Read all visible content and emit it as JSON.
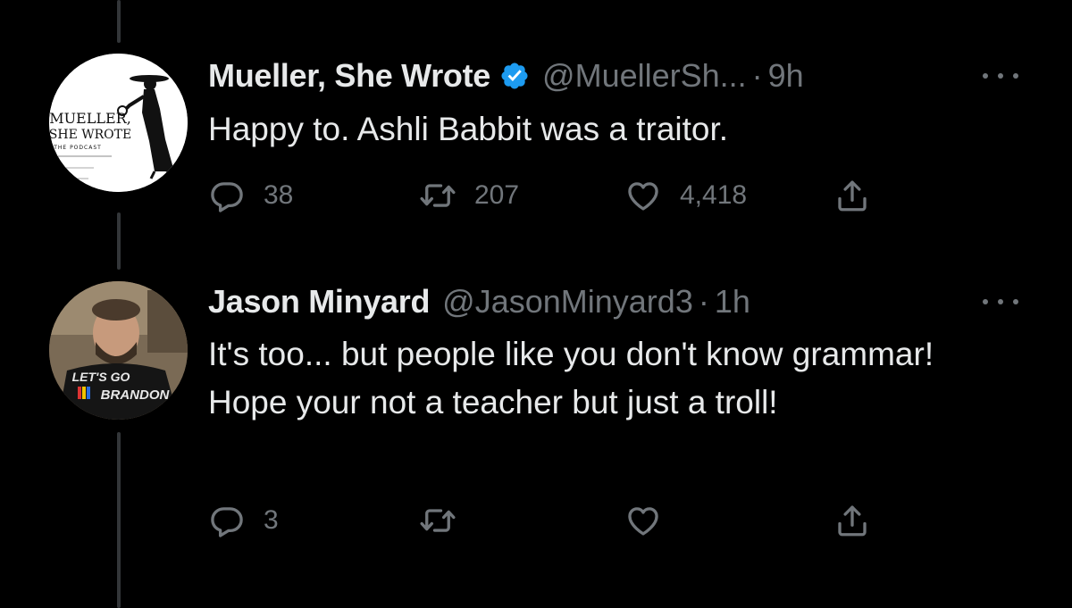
{
  "colors": {
    "background": "#000000",
    "text_primary": "#e7e9ea",
    "text_secondary": "#71767b",
    "verified_badge": "#1d9bf0",
    "thread_line": "#333639"
  },
  "tweets": [
    {
      "avatar": {
        "kind": "podcast-logo",
        "logo_line1": "MUELLER,",
        "logo_line2": "SHE WROTE",
        "logo_line3": "THE PODCAST"
      },
      "display_name": "Mueller, She Wrote",
      "verified": true,
      "handle": "@MuellerSh...",
      "separator": "·",
      "time": "9h",
      "text": "Happy to. Ashli Babbit was a traitor.",
      "actions": {
        "reply_icon": "reply-icon",
        "reply_count": "38",
        "retweet_icon": "retweet-icon",
        "retweet_count": "207",
        "like_icon": "like-icon",
        "like_count": "4,418",
        "share_icon": "share-icon"
      }
    },
    {
      "avatar": {
        "kind": "user-photo",
        "shirt_text_line1": "LET'S GO",
        "shirt_text_line2": "BRANDON"
      },
      "display_name": "Jason Minyard",
      "verified": false,
      "handle": "@JasonMinyard3",
      "separator": "·",
      "time": "1h",
      "text": "It's too... but people like you don't know grammar! Hope your not a teacher but just a troll!",
      "actions": {
        "reply_icon": "reply-icon",
        "reply_count": "3",
        "retweet_icon": "retweet-icon",
        "retweet_count": "",
        "like_icon": "like-icon",
        "like_count": "",
        "share_icon": "share-icon"
      }
    }
  ]
}
